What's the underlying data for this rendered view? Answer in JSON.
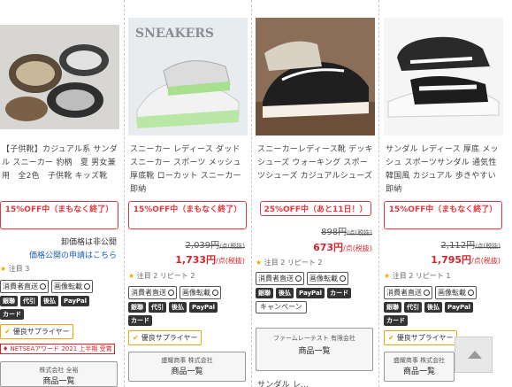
{
  "products": [
    {
      "title": "【子供靴】カジュアル系 サンダル スニーカー 豹柄　夏 男女兼用　全2色　子供靴 キッズ靴",
      "sale": "15%OFF中（まもなく終了）",
      "public_price": "卸価格は非公開",
      "apply_link": "価格公開の申請はこちら",
      "meta": "注目 3",
      "tags_outline": [
        "消費者直送",
        "画像転載"
      ],
      "tags_black": [
        "銀聯",
        "代引",
        "後払",
        "PayPal",
        "カード"
      ],
      "good_supplier": "優良サプライヤー",
      "award": "NETSEAアワード 2021 上半期 受賞",
      "shop_name": "株式会社 全裕",
      "shop_list": "商品一覧"
    },
    {
      "title": "スニーカー レディース ダッドスニーカー スポーツ メッシュ 厚底靴 ローカット スニーカー 即納",
      "sale": "15%OFF中（まもなく終了）",
      "old_price": "2,039円",
      "old_unit": "/点(税抜)",
      "new_price": "1,733円",
      "new_unit": "/点(税抜)",
      "meta": "注目 2 リピート 2",
      "tags_outline": [
        "消費者直送",
        "画像転載"
      ],
      "tags_black": [
        "銀聯",
        "代引",
        "後払",
        "PayPal",
        "カード"
      ],
      "good_supplier": "優良サプライヤー",
      "shop_name": "盛耀商事 株式会社",
      "shop_list": "商品一覧"
    },
    {
      "title": "スニーカーレディース靴 デッキシューズ ウォーキング スポーツシューズ カジュアルシューズ",
      "sale": "25%OFF中（あと11日！）",
      "old_price": "898円",
      "old_unit": "/点(税抜)",
      "new_price": "673円",
      "new_unit": "/点(税抜)",
      "meta": "注目 2 リピート 2",
      "tags_outline": [
        "消費者直送",
        "画像転載"
      ],
      "tags_black": [
        "銀聯",
        "後払",
        "PayPal",
        "カード"
      ],
      "campaign": "キャンペーン",
      "shop_name": "ファームレーテスト 有限会社",
      "shop_list": "商品一覧",
      "next_title": "サンダル レ..."
    },
    {
      "title": "サンダル レディース 厚底 メッシュ スポーツサンダル 通気性 韓国風 カジュアル 歩きやすい 即納",
      "sale": "15%OFF中（まもなく終了）",
      "old_price": "2,112円",
      "old_unit": "/点(税抜)",
      "new_price": "1,795円",
      "new_unit": "/点(税抜)",
      "meta": "注目 2 リピート 1",
      "tags_outline": [
        "消費者直送",
        "画像転載"
      ],
      "tags_black": [
        "銀聯",
        "代引",
        "後払",
        "PayPal",
        "カード"
      ],
      "good_supplier": "優良サプライヤー",
      "shop_name": "盛耀商事 株式会社",
      "shop_list": "商品一覧"
    }
  ],
  "icons": {
    "back_to_top": "triangle-up-icon",
    "star": "trophy-icon"
  }
}
